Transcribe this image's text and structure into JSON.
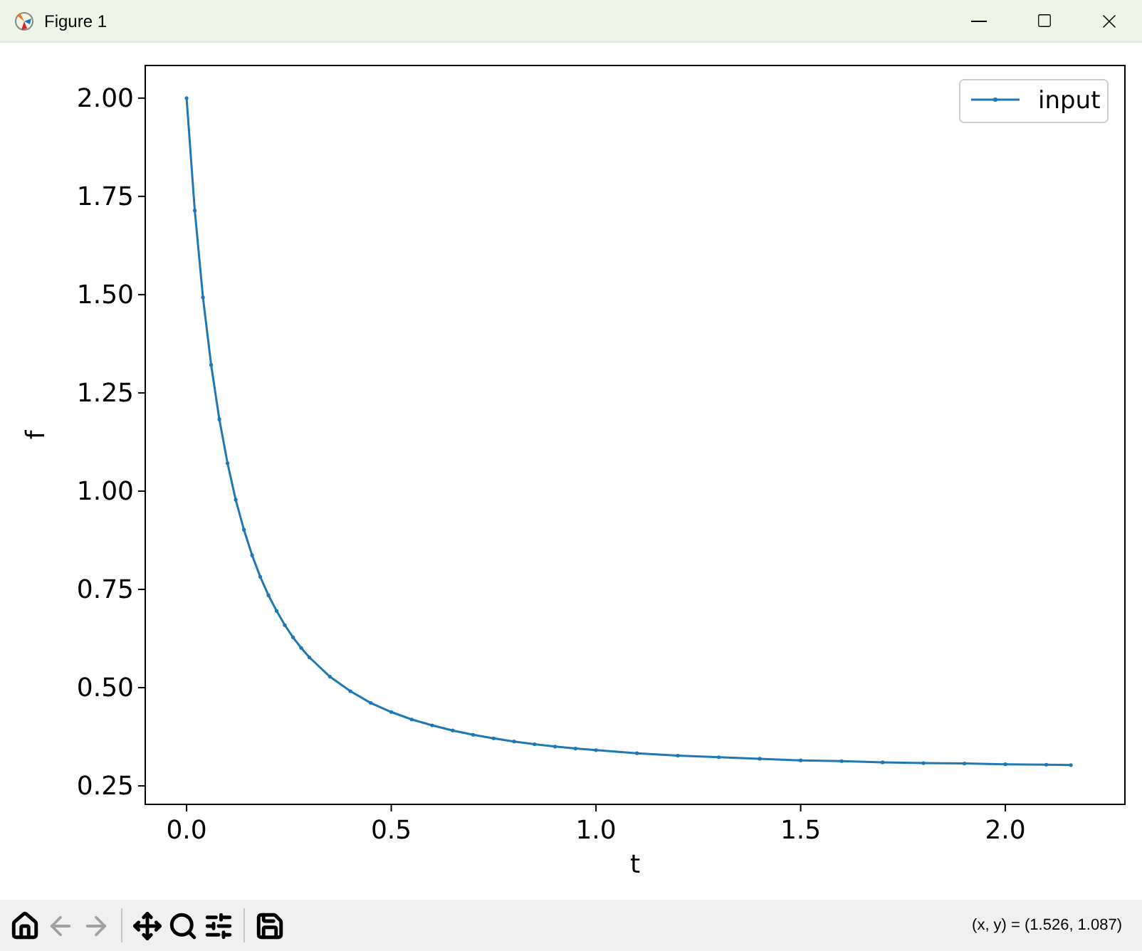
{
  "window": {
    "title": "Figure 1"
  },
  "figure": {
    "chart_data": {
      "type": "line",
      "xlabel": "t",
      "ylabel": "f",
      "x": [
        0,
        0.02,
        0.04,
        0.06,
        0.08,
        0.1,
        0.12,
        0.14,
        0.16,
        0.18,
        0.2,
        0.22,
        0.24,
        0.26,
        0.28,
        0.3,
        0.35,
        0.4,
        0.45,
        0.5,
        0.55,
        0.6,
        0.65,
        0.7,
        0.75,
        0.8,
        0.85,
        0.9,
        0.95,
        1.0,
        1.1,
        1.2,
        1.3,
        1.4,
        1.5,
        1.6,
        1.7,
        1.8,
        1.9,
        2.0,
        2.1,
        2.16
      ],
      "series": [
        {
          "name": "input",
          "color": "#1f77b4",
          "values": [
            2.0,
            1.714,
            1.493,
            1.321,
            1.183,
            1.071,
            0.978,
            0.902,
            0.837,
            0.782,
            0.735,
            0.695,
            0.659,
            0.628,
            0.601,
            0.577,
            0.528,
            0.491,
            0.461,
            0.438,
            0.419,
            0.404,
            0.391,
            0.38,
            0.371,
            0.363,
            0.356,
            0.35,
            0.345,
            0.341,
            0.333,
            0.327,
            0.323,
            0.319,
            0.315,
            0.313,
            0.31,
            0.308,
            0.307,
            0.305,
            0.304,
            0.303
          ]
        }
      ],
      "xlim": [
        -0.101,
        2.292
      ],
      "ylim": [
        0.203,
        2.083
      ],
      "xticks": [
        {
          "value": 0,
          "label": "0.0"
        },
        {
          "value": 0.5,
          "label": "0.5"
        },
        {
          "value": 1,
          "label": "1.0"
        },
        {
          "value": 1.5,
          "label": "1.5"
        },
        {
          "value": 2,
          "label": "2.0"
        }
      ],
      "yticks": [
        {
          "value": 0.25,
          "label": "0.25"
        },
        {
          "value": 0.5,
          "label": "0.50"
        },
        {
          "value": 0.75,
          "label": "0.75"
        },
        {
          "value": 1,
          "label": "1.00"
        },
        {
          "value": 1.25,
          "label": "1.25"
        },
        {
          "value": 1.5,
          "label": "1.50"
        },
        {
          "value": 1.75,
          "label": "1.75"
        },
        {
          "value": 2,
          "label": "2.00"
        }
      ]
    }
  },
  "toolbar": {
    "buttons": [
      {
        "kind": "home",
        "disabled": false
      },
      {
        "kind": "back",
        "disabled": true
      },
      {
        "kind": "forward",
        "disabled": true
      },
      {
        "kind": "pan",
        "disabled": false
      },
      {
        "kind": "zoom",
        "disabled": false
      },
      {
        "kind": "configure",
        "disabled": false
      },
      {
        "kind": "save",
        "disabled": false
      }
    ],
    "status": "(x, y) = (1.526, 1.087)"
  }
}
